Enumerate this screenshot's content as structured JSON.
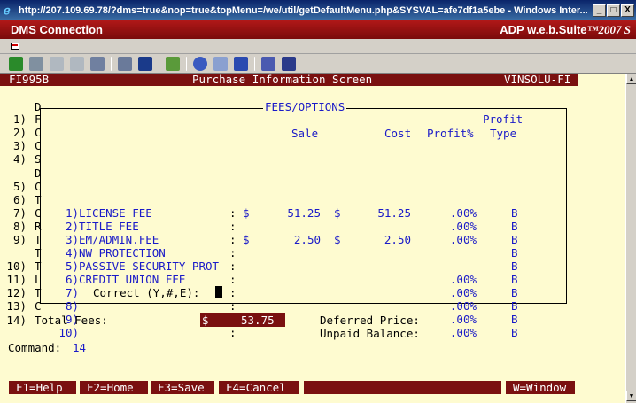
{
  "window": {
    "title": "http://207.109.69.78/?dms=true&nop=true&topMenu=/we/util/getDefaultMenu.php&SYSVAL=afe7df1a5ebe - Windows Inter...",
    "controls": [
      "_",
      "□",
      "X"
    ]
  },
  "app": {
    "name": "DMS Connection",
    "brand_prefix": "ADP ",
    "brand_name": "w.e.b.Suite",
    "brand_suffix": "™2007 S"
  },
  "screen": {
    "id": "FI995B",
    "title": "Purchase Information Screen",
    "user": "VINSOLU-FI"
  },
  "left_menu": [
    {
      "n": "",
      "c": "D"
    },
    {
      "n": "1)",
      "c": "F"
    },
    {
      "n": "2)",
      "c": "C"
    },
    {
      "n": "3)",
      "c": "C"
    },
    {
      "n": "4)",
      "c": "S"
    },
    {
      "n": "",
      "c": "D"
    },
    {
      "n": "5)",
      "c": "C"
    },
    {
      "n": "6)",
      "c": "T"
    },
    {
      "n": "7)",
      "c": "C"
    },
    {
      "n": "8)",
      "c": "R"
    },
    {
      "n": "9)",
      "c": "T"
    },
    {
      "n": "",
      "c": "T"
    },
    {
      "n": "10)",
      "c": "T"
    },
    {
      "n": "11)",
      "c": "L"
    },
    {
      "n": "12)",
      "c": "T"
    },
    {
      "n": "13)",
      "c": "C"
    }
  ],
  "fees": {
    "title": "FEES/OPTIONS",
    "headers": {
      "profit_top": "Profit",
      "sale": "Sale",
      "cost": "Cost",
      "profit_pct": "Profit%",
      "type": "Type"
    },
    "rows": [
      {
        "num": "1)",
        "name": "LICENSE FEE",
        "sale_sym": "$",
        "sale": "51.25",
        "cost_sym": "$",
        "cost": "51.25",
        "pct": ".00%",
        "type": "B"
      },
      {
        "num": "2)",
        "name": "TITLE FEE",
        "sale_sym": "",
        "sale": "",
        "cost_sym": "",
        "cost": "",
        "pct": ".00%",
        "type": "B"
      },
      {
        "num": "3)",
        "name": "EM/ADMIN.FEE",
        "sale_sym": "$",
        "sale": "2.50",
        "cost_sym": "$",
        "cost": "2.50",
        "pct": ".00%",
        "type": "B"
      },
      {
        "num": "4)",
        "name": "NW PROTECTION",
        "sale_sym": "",
        "sale": "",
        "cost_sym": "",
        "cost": "",
        "pct": "",
        "type": "B"
      },
      {
        "num": "5)",
        "name": "PASSIVE SECURITY PROT",
        "sale_sym": "",
        "sale": "",
        "cost_sym": "",
        "cost": "",
        "pct": "",
        "type": "B"
      },
      {
        "num": "6)",
        "name": "CREDIT UNION FEE",
        "sale_sym": "",
        "sale": "",
        "cost_sym": "",
        "cost": "",
        "pct": ".00%",
        "type": "B"
      },
      {
        "num": "7)",
        "name": "",
        "sale_sym": "",
        "sale": "",
        "cost_sym": "",
        "cost": "",
        "pct": ".00%",
        "type": "B"
      },
      {
        "num": "8)",
        "name": "",
        "sale_sym": "",
        "sale": "",
        "cost_sym": "",
        "cost": "",
        "pct": ".00%",
        "type": "B"
      },
      {
        "num": "9)",
        "name": "",
        "sale_sym": "",
        "sale": "",
        "cost_sym": "",
        "cost": "",
        "pct": ".00%",
        "type": "B"
      },
      {
        "num": "10)",
        "name": "",
        "sale_sym": "",
        "sale": "",
        "cost_sym": "",
        "cost": "",
        "pct": ".00%",
        "type": "B"
      }
    ],
    "prompt": "Correct (Y,#,E):"
  },
  "totals": {
    "label": "14) Total Fees:",
    "currency": "$",
    "value": "53.75",
    "deferred_label": "Deferred Price:",
    "unpaid_label": "Unpaid Balance:"
  },
  "command": {
    "label": "Command:",
    "value": "14"
  },
  "function_keys": {
    "f1": "F1=Help",
    "f2": "F2=Home",
    "f3": "F3=Save",
    "f4": "F4=Cancel",
    "window": "W=Window"
  }
}
